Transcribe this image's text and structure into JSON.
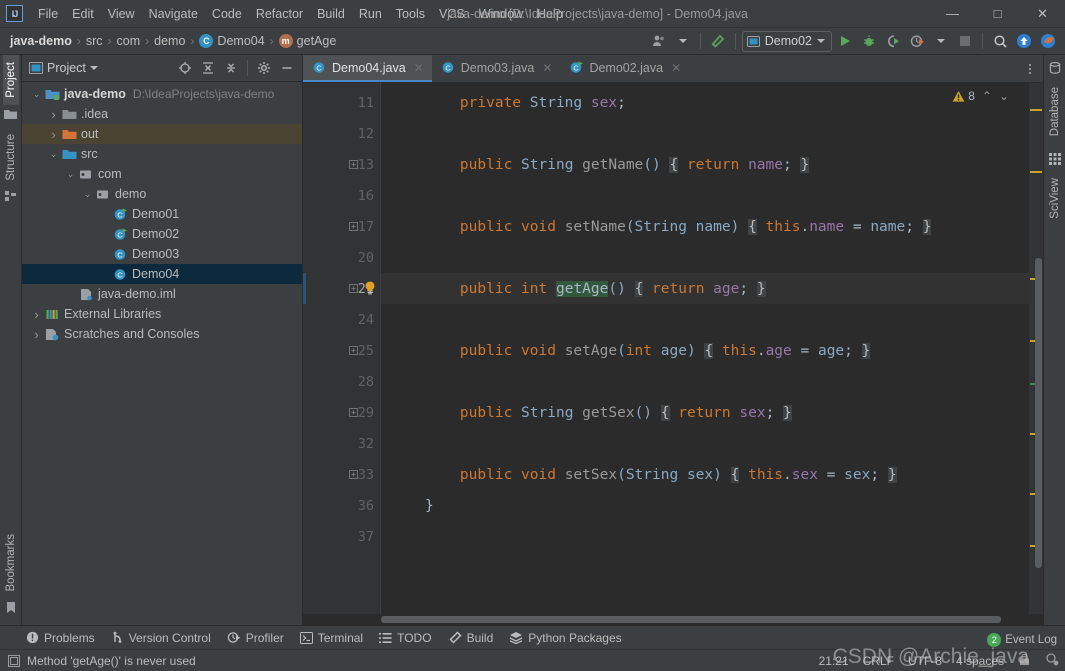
{
  "window": {
    "title": "java-demo [D:\\IdeaProjects\\java-demo] - Demo04.java",
    "minimize": "—",
    "maximize": "□",
    "close": "✕",
    "logo": "IJ"
  },
  "menu": {
    "items": [
      "File",
      "Edit",
      "View",
      "Navigate",
      "Code",
      "Refactor",
      "Build",
      "Run",
      "Tools",
      "VCS",
      "Window",
      "Help"
    ]
  },
  "navbar": {
    "breadcrumb": [
      {
        "label": "java-demo",
        "icon": ""
      },
      {
        "label": "src",
        "icon": ""
      },
      {
        "label": "com",
        "icon": ""
      },
      {
        "label": "demo",
        "icon": ""
      },
      {
        "label": "Demo04",
        "icon": "class-badge",
        "badge": "C"
      },
      {
        "label": "getAge",
        "icon": "method-badge",
        "badge": "m"
      }
    ],
    "separator": "›",
    "run_configuration": "Demo02",
    "icons": {
      "profile": "user-group-icon",
      "hammer": "build-hammer-icon",
      "run": "run-icon",
      "debug": "debug-icon",
      "coverage": "run-with-coverage-icon",
      "profiler": "profiler-icon",
      "stop": "stop-icon",
      "search": "search-everywhere-icon",
      "update": "update-project-icon",
      "share": "share-icon"
    }
  },
  "left_strip": {
    "tools": [
      "Project",
      "Structure",
      "Bookmarks"
    ]
  },
  "right_strip": {
    "tools": [
      "Database",
      "SciView"
    ]
  },
  "project_panel": {
    "title": "Project",
    "header_icons": [
      "select-opened-file-icon",
      "expand-all-icon",
      "collapse-all-icon",
      "settings-gear-icon",
      "hide-icon"
    ],
    "tree": [
      {
        "indent": 0,
        "arrow": "v",
        "icon": "module-folder",
        "label": "java-demo",
        "bold": true,
        "path": "D:\\IdeaProjects\\java-demo",
        "state": "normal"
      },
      {
        "indent": 1,
        "arrow": ">",
        "icon": "folder-gray",
        "label": ".idea",
        "bold": false,
        "path": "",
        "state": "normal"
      },
      {
        "indent": 1,
        "arrow": ">",
        "icon": "folder-orange",
        "label": "out",
        "bold": false,
        "path": "",
        "state": "highlight"
      },
      {
        "indent": 1,
        "arrow": "v",
        "icon": "folder-blue",
        "label": "src",
        "bold": false,
        "path": "",
        "state": "normal"
      },
      {
        "indent": 2,
        "arrow": "v",
        "icon": "package",
        "label": "com",
        "bold": false,
        "path": "",
        "state": "normal"
      },
      {
        "indent": 3,
        "arrow": "v",
        "icon": "package",
        "label": "demo",
        "bold": false,
        "path": "",
        "state": "normal"
      },
      {
        "indent": 4,
        "arrow": "",
        "icon": "class-runnable",
        "label": "Demo01",
        "bold": false,
        "path": "",
        "state": "normal"
      },
      {
        "indent": 4,
        "arrow": "",
        "icon": "class-runnable",
        "label": "Demo02",
        "bold": false,
        "path": "",
        "state": "normal"
      },
      {
        "indent": 4,
        "arrow": "",
        "icon": "class",
        "label": "Demo03",
        "bold": false,
        "path": "",
        "state": "normal"
      },
      {
        "indent": 4,
        "arrow": "",
        "icon": "class",
        "label": "Demo04",
        "bold": false,
        "path": "",
        "state": "selected"
      },
      {
        "indent": 2,
        "arrow": "",
        "icon": "iml-file",
        "label": "java-demo.iml",
        "bold": false,
        "path": "",
        "state": "normal"
      },
      {
        "indent": 0,
        "arrow": ">",
        "icon": "libraries",
        "label": "External Libraries",
        "bold": false,
        "path": "",
        "state": "normal"
      },
      {
        "indent": 0,
        "arrow": ">",
        "icon": "scratches",
        "label": "Scratches and Consoles",
        "bold": false,
        "path": "",
        "state": "normal"
      }
    ]
  },
  "editor": {
    "tabs": [
      {
        "label": "Demo04.java",
        "icon": "class",
        "active": true,
        "close": "✕"
      },
      {
        "label": "Demo03.java",
        "icon": "class",
        "active": false,
        "close": "✕"
      },
      {
        "label": "Demo02.java",
        "icon": "class-runnable",
        "active": false,
        "close": "✕"
      }
    ],
    "inspection": {
      "warning_count": "8",
      "warning_glyph": "!",
      "prev": "⌃",
      "next": "⌄"
    },
    "current_line": 21,
    "lines": [
      {
        "num": "11",
        "fold": false,
        "bulb": false,
        "current": false,
        "tokens": [
          {
            "t": "    ",
            "c": "pun"
          },
          {
            "t": "private",
            "c": "kw"
          },
          {
            "t": " ",
            "c": "pun"
          },
          {
            "t": "String",
            "c": "typ"
          },
          {
            "t": " ",
            "c": "pun"
          },
          {
            "t": "sex",
            "c": "fld"
          },
          {
            "t": ";",
            "c": "pun"
          }
        ]
      },
      {
        "num": "12",
        "fold": false,
        "bulb": false,
        "current": false,
        "tokens": []
      },
      {
        "num": "13",
        "fold": true,
        "bulb": false,
        "current": false,
        "tokens": [
          {
            "t": "    ",
            "c": "pun"
          },
          {
            "t": "public",
            "c": "kw"
          },
          {
            "t": " ",
            "c": "pun"
          },
          {
            "t": "String",
            "c": "typ"
          },
          {
            "t": " ",
            "c": "pun"
          },
          {
            "t": "getName",
            "c": "mth"
          },
          {
            "t": "()",
            "c": "typ"
          },
          {
            "t": " ",
            "c": "pun"
          },
          {
            "t": "{",
            "c": "brace-box"
          },
          {
            "t": " ",
            "c": "pun"
          },
          {
            "t": "return",
            "c": "kw"
          },
          {
            "t": " ",
            "c": "pun"
          },
          {
            "t": "name",
            "c": "fld"
          },
          {
            "t": ";",
            "c": "pun"
          },
          {
            "t": " ",
            "c": "pun"
          },
          {
            "t": "}",
            "c": "brace-box"
          }
        ]
      },
      {
        "num": "16",
        "fold": false,
        "bulb": false,
        "current": false,
        "tokens": []
      },
      {
        "num": "17",
        "fold": true,
        "bulb": false,
        "current": false,
        "tokens": [
          {
            "t": "    ",
            "c": "pun"
          },
          {
            "t": "public",
            "c": "kw"
          },
          {
            "t": " ",
            "c": "pun"
          },
          {
            "t": "void",
            "c": "kw"
          },
          {
            "t": " ",
            "c": "pun"
          },
          {
            "t": "setName",
            "c": "mth"
          },
          {
            "t": "(",
            "c": "typ"
          },
          {
            "t": "String",
            "c": "typ"
          },
          {
            "t": " ",
            "c": "pun"
          },
          {
            "t": "name",
            "c": "typ"
          },
          {
            "t": ")",
            "c": "typ"
          },
          {
            "t": " ",
            "c": "pun"
          },
          {
            "t": "{",
            "c": "brace-box"
          },
          {
            "t": " ",
            "c": "pun"
          },
          {
            "t": "this",
            "c": "kw"
          },
          {
            "t": ".",
            "c": "pun"
          },
          {
            "t": "name",
            "c": "fld"
          },
          {
            "t": " = ",
            "c": "pun"
          },
          {
            "t": "name",
            "c": "typ"
          },
          {
            "t": ";",
            "c": "pun"
          },
          {
            "t": " ",
            "c": "pun"
          },
          {
            "t": "}",
            "c": "brace-box"
          }
        ]
      },
      {
        "num": "20",
        "fold": false,
        "bulb": false,
        "current": false,
        "tokens": []
      },
      {
        "num": "21",
        "fold": true,
        "bulb": true,
        "current": true,
        "tokens": [
          {
            "t": "    ",
            "c": "pun"
          },
          {
            "t": "public",
            "c": "kw"
          },
          {
            "t": " ",
            "c": "pun"
          },
          {
            "t": "int",
            "c": "kw"
          },
          {
            "t": " ",
            "c": "pun"
          },
          {
            "t": "getAge",
            "c": "searchhl"
          },
          {
            "t": "()",
            "c": "typ"
          },
          {
            "t": " ",
            "c": "pun"
          },
          {
            "t": "{",
            "c": "brace-box"
          },
          {
            "t": " ",
            "c": "pun"
          },
          {
            "t": "return",
            "c": "kw"
          },
          {
            "t": " ",
            "c": "pun"
          },
          {
            "t": "age",
            "c": "fld"
          },
          {
            "t": ";",
            "c": "pun"
          },
          {
            "t": " ",
            "c": "pun"
          },
          {
            "t": "}",
            "c": "brace-box"
          }
        ]
      },
      {
        "num": "24",
        "fold": false,
        "bulb": false,
        "current": false,
        "tokens": []
      },
      {
        "num": "25",
        "fold": true,
        "bulb": false,
        "current": false,
        "tokens": [
          {
            "t": "    ",
            "c": "pun"
          },
          {
            "t": "public",
            "c": "kw"
          },
          {
            "t": " ",
            "c": "pun"
          },
          {
            "t": "void",
            "c": "kw"
          },
          {
            "t": " ",
            "c": "pun"
          },
          {
            "t": "setAge",
            "c": "mth"
          },
          {
            "t": "(",
            "c": "typ"
          },
          {
            "t": "int",
            "c": "kw"
          },
          {
            "t": " ",
            "c": "pun"
          },
          {
            "t": "age",
            "c": "typ"
          },
          {
            "t": ")",
            "c": "typ"
          },
          {
            "t": " ",
            "c": "pun"
          },
          {
            "t": "{",
            "c": "brace-box"
          },
          {
            "t": " ",
            "c": "pun"
          },
          {
            "t": "this",
            "c": "kw"
          },
          {
            "t": ".",
            "c": "pun"
          },
          {
            "t": "age",
            "c": "fld"
          },
          {
            "t": " = ",
            "c": "pun"
          },
          {
            "t": "age",
            "c": "typ"
          },
          {
            "t": ";",
            "c": "pun"
          },
          {
            "t": " ",
            "c": "pun"
          },
          {
            "t": "}",
            "c": "brace-box"
          }
        ]
      },
      {
        "num": "28",
        "fold": false,
        "bulb": false,
        "current": false,
        "tokens": []
      },
      {
        "num": "29",
        "fold": true,
        "bulb": false,
        "current": false,
        "tokens": [
          {
            "t": "    ",
            "c": "pun"
          },
          {
            "t": "public",
            "c": "kw"
          },
          {
            "t": " ",
            "c": "pun"
          },
          {
            "t": "String",
            "c": "typ"
          },
          {
            "t": " ",
            "c": "pun"
          },
          {
            "t": "getSex",
            "c": "mth"
          },
          {
            "t": "()",
            "c": "typ"
          },
          {
            "t": " ",
            "c": "pun"
          },
          {
            "t": "{",
            "c": "brace-box"
          },
          {
            "t": " ",
            "c": "pun"
          },
          {
            "t": "return",
            "c": "kw"
          },
          {
            "t": " ",
            "c": "pun"
          },
          {
            "t": "sex",
            "c": "fld"
          },
          {
            "t": ";",
            "c": "pun"
          },
          {
            "t": " ",
            "c": "pun"
          },
          {
            "t": "}",
            "c": "brace-box"
          }
        ]
      },
      {
        "num": "32",
        "fold": false,
        "bulb": false,
        "current": false,
        "tokens": []
      },
      {
        "num": "33",
        "fold": true,
        "bulb": false,
        "current": false,
        "tokens": [
          {
            "t": "    ",
            "c": "pun"
          },
          {
            "t": "public",
            "c": "kw"
          },
          {
            "t": " ",
            "c": "pun"
          },
          {
            "t": "void",
            "c": "kw"
          },
          {
            "t": " ",
            "c": "pun"
          },
          {
            "t": "setSex",
            "c": "mth"
          },
          {
            "t": "(",
            "c": "typ"
          },
          {
            "t": "String",
            "c": "typ"
          },
          {
            "t": " ",
            "c": "pun"
          },
          {
            "t": "sex",
            "c": "typ"
          },
          {
            "t": ")",
            "c": "typ"
          },
          {
            "t": " ",
            "c": "pun"
          },
          {
            "t": "{",
            "c": "brace-box"
          },
          {
            "t": " ",
            "c": "pun"
          },
          {
            "t": "this",
            "c": "kw"
          },
          {
            "t": ".",
            "c": "pun"
          },
          {
            "t": "sex",
            "c": "fld"
          },
          {
            "t": " = ",
            "c": "pun"
          },
          {
            "t": "sex",
            "c": "typ"
          },
          {
            "t": ";",
            "c": "pun"
          },
          {
            "t": " ",
            "c": "pun"
          },
          {
            "t": "}",
            "c": "brace-box"
          }
        ]
      },
      {
        "num": "36",
        "fold": false,
        "bulb": false,
        "current": false,
        "tokens": [
          {
            "t": "}",
            "c": "pun"
          }
        ]
      },
      {
        "num": "37",
        "fold": false,
        "bulb": false,
        "current": false,
        "tokens": []
      }
    ]
  },
  "tool_windows": [
    {
      "label": "Problems",
      "icon": "problems-icon"
    },
    {
      "label": "Version Control",
      "icon": "vcs-branch-icon"
    },
    {
      "label": "Profiler",
      "icon": "profiler-icon"
    },
    {
      "label": "Terminal",
      "icon": "terminal-icon"
    },
    {
      "label": "TODO",
      "icon": "todo-list-icon"
    },
    {
      "label": "Build",
      "icon": "build-hammer-icon"
    },
    {
      "label": "Python Packages",
      "icon": "packages-icon"
    }
  ],
  "status_bar": {
    "message": "Method 'getAge()' is never used",
    "message_icon": "inspection-icon",
    "caret_position": "21:21",
    "line_separator": "CRLF",
    "encoding": "UTF-8",
    "indent": "4 spaces",
    "lock_icon": "read-only-lock-icon",
    "inspection_icon": "inspection-settings-icon"
  },
  "event_log": {
    "label": "Event Log",
    "count": "2"
  },
  "watermark": "CSDN @Archie_java",
  "colors": {
    "panel_bg": "#3c3f41",
    "editor_bg": "#2b2b2b",
    "gutter_bg": "#313335",
    "selection": "#0d293e",
    "accent_blue": "#4a88c7",
    "keyword_orange": "#cc7832",
    "field_purple": "#9876aa",
    "warning_yellow": "#c9a227"
  }
}
